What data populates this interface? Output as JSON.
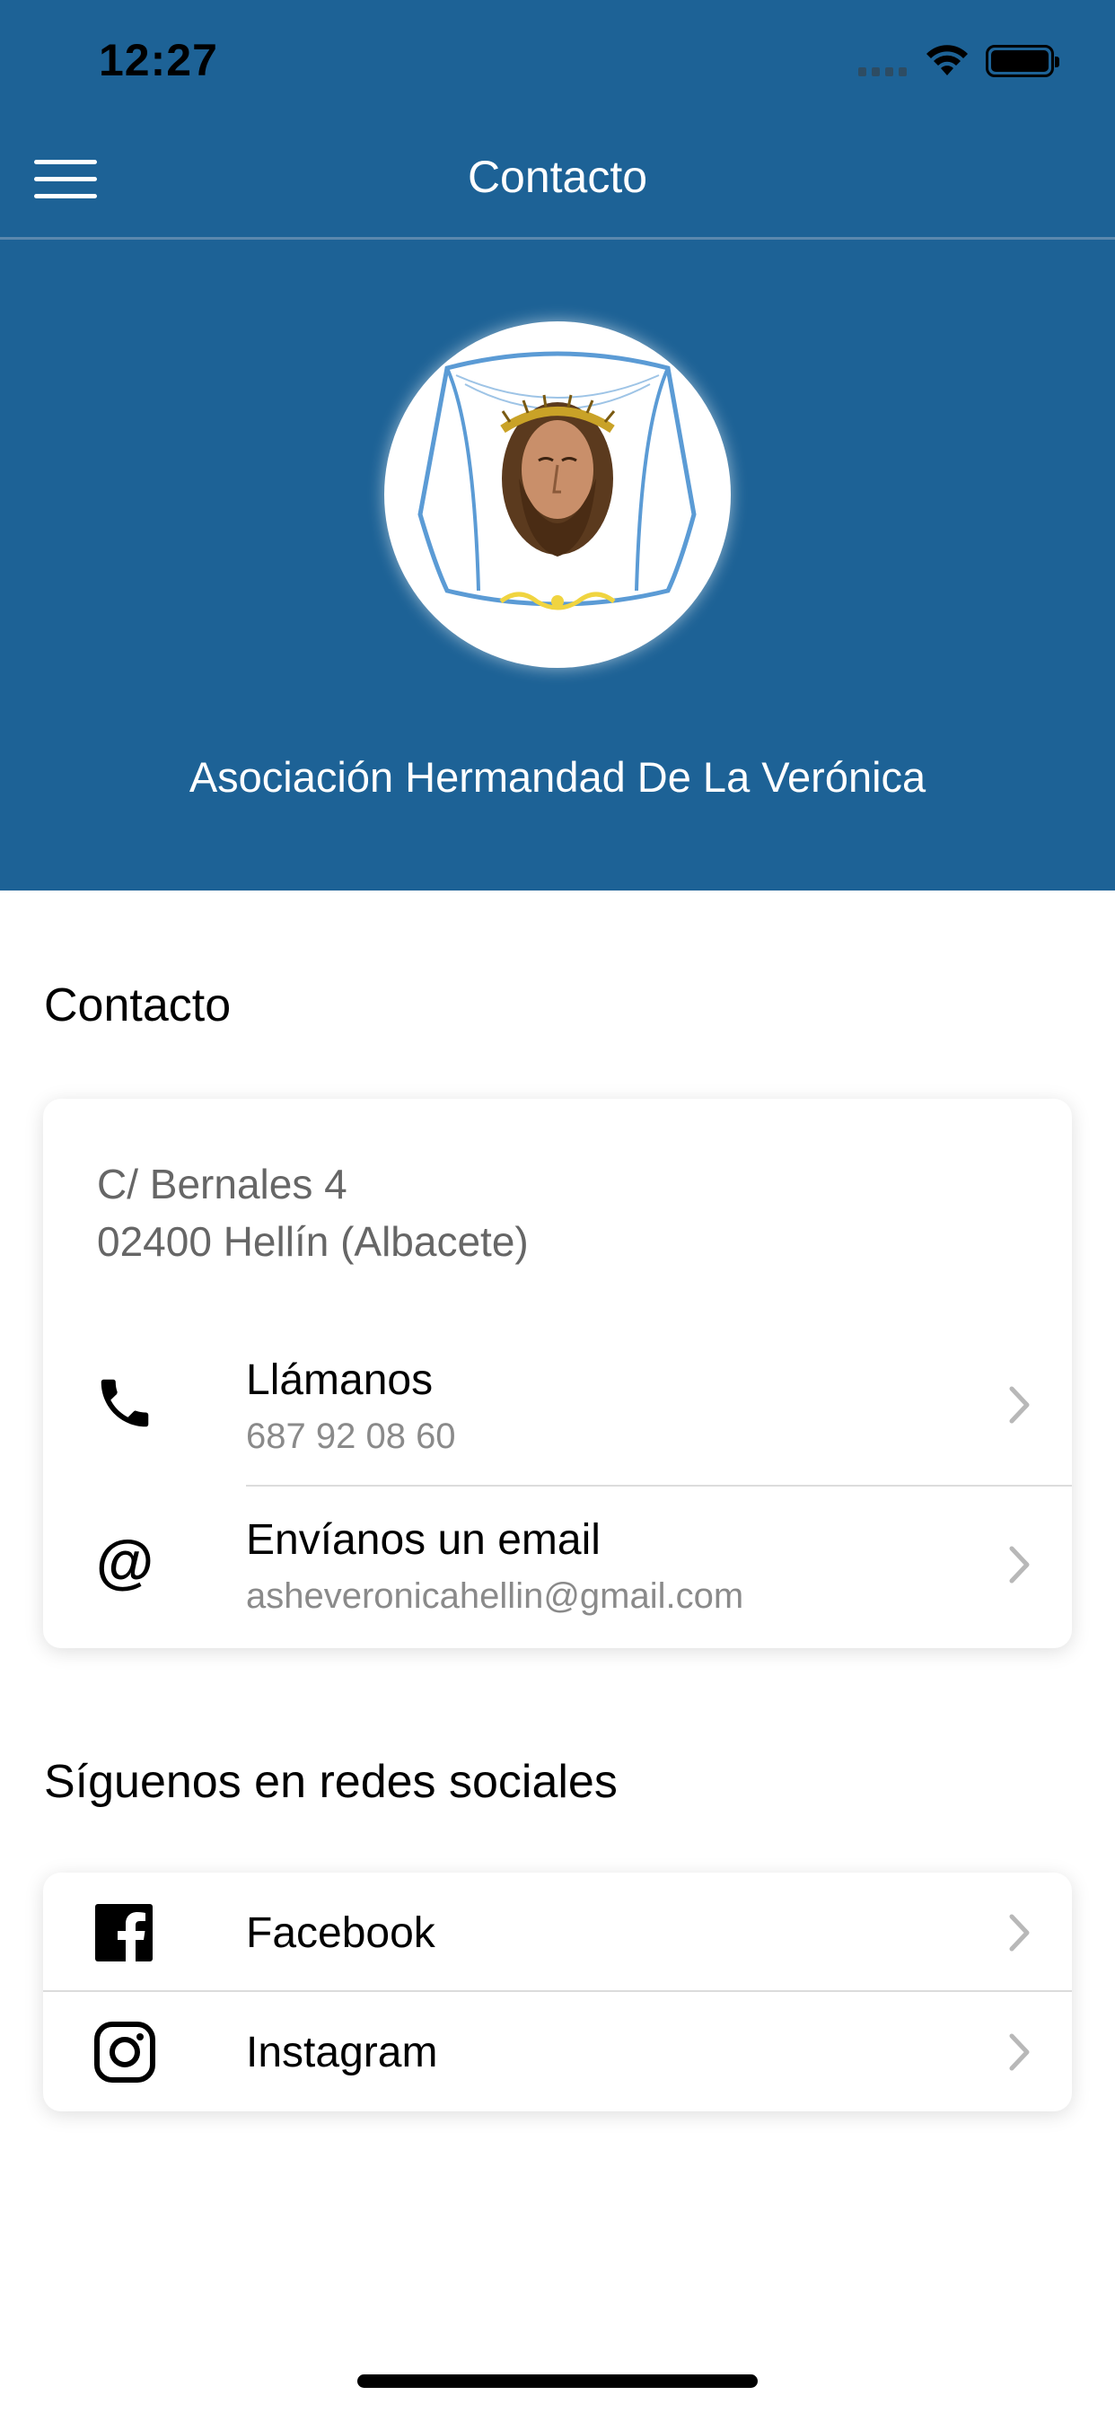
{
  "status_bar": {
    "time": "12:27"
  },
  "nav": {
    "title": "Contacto"
  },
  "header": {
    "org_name": "Asociación Hermandad De La Verónica"
  },
  "contact_section": {
    "title": "Contacto",
    "address": {
      "line1": "C/ Bernales 4",
      "line2": "02400 Hellín (Albacete)"
    },
    "rows": [
      {
        "icon": "phone-icon",
        "title": "Llámanos",
        "subtitle": "687 92 08 60"
      },
      {
        "icon": "at-sign-icon",
        "title": "Envíanos un email",
        "subtitle": "asheveronicahellin@gmail.com"
      }
    ]
  },
  "social_section": {
    "title": "Síguenos en redes sociales",
    "rows": [
      {
        "icon": "facebook-icon",
        "title": "Facebook"
      },
      {
        "icon": "instagram-icon",
        "title": "Instagram"
      }
    ]
  },
  "colors": {
    "header_bg": "#1d6296",
    "text_secondary": "#8a8a8a",
    "chevron": "#b8b8b8"
  }
}
